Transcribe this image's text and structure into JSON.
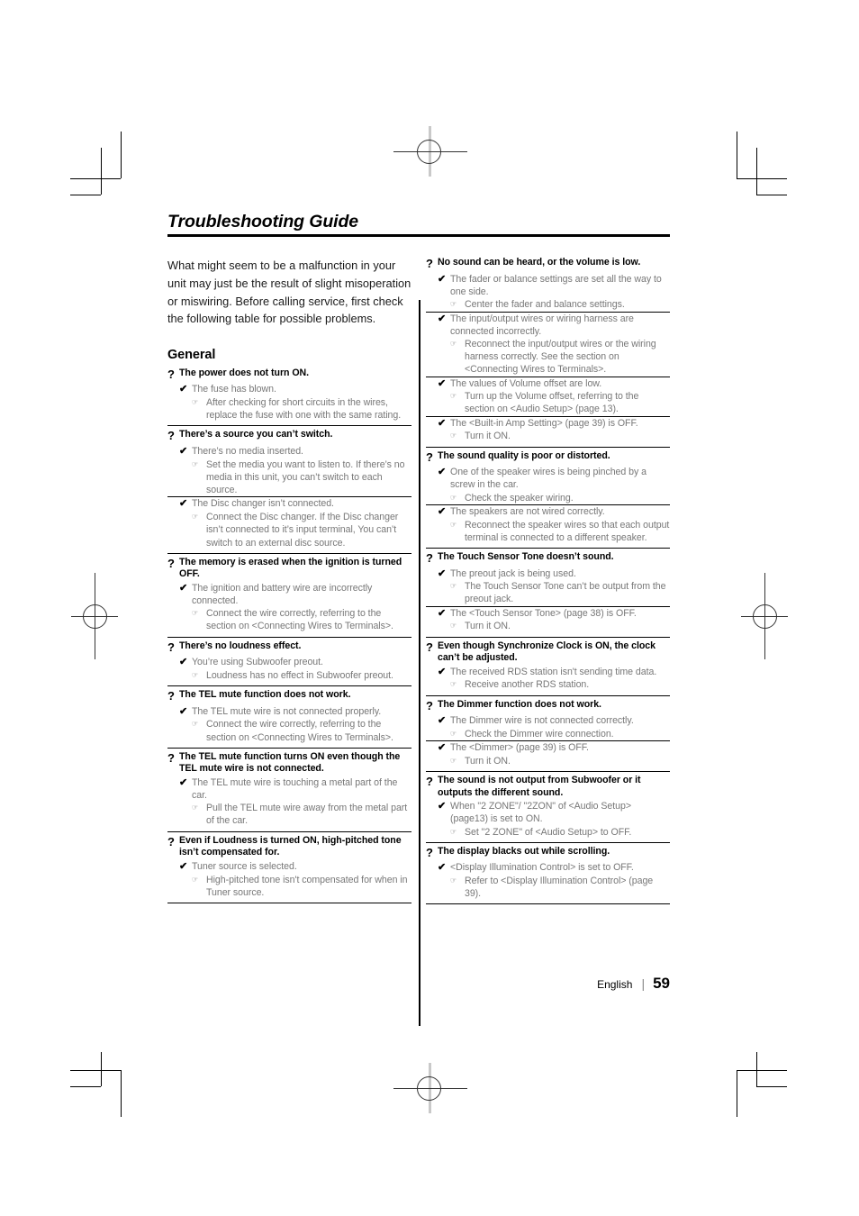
{
  "document": {
    "title": "Troubleshooting Guide",
    "intro": "What might seem to be a malfunction in your unit may just be the result of slight misoperation or miswiring. Before calling service, first check the following table for possible problems.",
    "section_heading": "General"
  },
  "markers": {
    "question": "?",
    "cause": "✔",
    "action": "☞"
  },
  "footer": {
    "language": "English",
    "separator": "|",
    "page_number": "59"
  },
  "left_column": [
    {
      "question": "The power does not turn ON.",
      "causes": [
        {
          "cause": "The fuse has blown.",
          "actions": [
            "After checking for short circuits in the wires, replace the fuse with one with the same rating."
          ]
        }
      ]
    },
    {
      "question": "There’s a source you can’t switch.",
      "causes": [
        {
          "cause": "There’s no media inserted.",
          "actions": [
            "Set the media you want to listen to. If there’s no media in this unit, you can’t switch to each source."
          ]
        },
        {
          "cause": "The Disc changer isn’t connected.",
          "actions": [
            "Connect the Disc changer. If the Disc changer isn’t connected to it’s input terminal, You can’t switch to an external disc source."
          ]
        }
      ]
    },
    {
      "question": "The memory is erased when the ignition is turned OFF.",
      "causes": [
        {
          "cause": "The ignition and battery wire are incorrectly connected.",
          "actions": [
            "Connect the wire correctly, referring to the section on <Connecting Wires to Terminals>."
          ]
        }
      ]
    },
    {
      "question": "There’s no loudness effect.",
      "causes": [
        {
          "cause": "You’re using Subwoofer preout.",
          "actions": [
            "Loudness has no effect in Subwoofer preout."
          ]
        }
      ]
    },
    {
      "question": "The TEL mute function does not work.",
      "causes": [
        {
          "cause": "The TEL mute wire is not connected properly.",
          "actions": [
            "Connect the wire correctly, referring to the section on <Connecting Wires to Terminals>."
          ]
        }
      ]
    },
    {
      "question": "The TEL mute function turns ON even though the TEL mute wire is not connected.",
      "causes": [
        {
          "cause": "The TEL mute wire is touching a metal part of the car.",
          "actions": [
            "Pull the TEL mute wire away from the metal part of the car."
          ]
        }
      ]
    },
    {
      "question": "Even if Loudness is turned ON, high-pitched tone isn’t compensated for.",
      "causes": [
        {
          "cause": "Tuner source is selected.",
          "actions": [
            "High-pitched tone isn't compensated for when in Tuner source."
          ]
        }
      ]
    }
  ],
  "right_column": [
    {
      "question": "No sound can be heard, or the volume is low.",
      "causes": [
        {
          "cause": "The fader or balance settings are set all the way to one side.",
          "actions": [
            "Center the fader and balance settings."
          ]
        },
        {
          "cause": "The input/output wires or wiring harness are connected incorrectly.",
          "actions": [
            "Reconnect the input/output wires or the wiring harness correctly. See the section on <Connecting Wires to Terminals>."
          ]
        },
        {
          "cause": "The values of Volume offset are low.",
          "actions": [
            "Turn up the Volume offset, referring to the section on <Audio Setup> (page 13)."
          ]
        },
        {
          "cause": "The <Built-in Amp Setting> (page 39) is OFF.",
          "actions": [
            "Turn it ON."
          ]
        }
      ]
    },
    {
      "question": "The sound quality is poor or distorted.",
      "causes": [
        {
          "cause": "One of the speaker wires is being pinched by a screw in the car.",
          "actions": [
            "Check the speaker wiring."
          ]
        },
        {
          "cause": "The speakers are not wired correctly.",
          "actions": [
            "Reconnect the speaker wires so that each output terminal is connected to a different speaker."
          ]
        }
      ]
    },
    {
      "question": "The Touch Sensor Tone doesn’t sound.",
      "causes": [
        {
          "cause": "The preout jack is being used.",
          "actions": [
            "The Touch Sensor Tone can’t be output from the preout jack."
          ]
        },
        {
          "cause": "The <Touch Sensor Tone> (page 38) is OFF.",
          "actions": [
            "Turn it ON."
          ]
        }
      ]
    },
    {
      "question": "Even though Synchronize Clock is ON, the clock can’t be adjusted.",
      "causes": [
        {
          "cause": "The received RDS station isn't sending time data.",
          "actions": [
            "Receive another RDS station."
          ]
        }
      ]
    },
    {
      "question": "The Dimmer function does not work.",
      "causes": [
        {
          "cause": "The Dimmer wire is not connected correctly.",
          "actions": [
            "Check the Dimmer wire connection."
          ]
        },
        {
          "cause": "The <Dimmer> (page 39) is OFF.",
          "actions": [
            "Turn it ON."
          ]
        }
      ]
    },
    {
      "question": "The sound is not output from Subwoofer or it outputs the different sound.",
      "causes": [
        {
          "cause": "When \"2 ZONE\"/ \"2ZON\" of <Audio Setup> (page13) is set to ON.",
          "actions": [
            "Set \"2 ZONE\" of <Audio Setup> to OFF."
          ]
        }
      ]
    },
    {
      "question": "The display blacks out while scrolling.",
      "causes": [
        {
          "cause": "<Display Illumination Control> is set to OFF.",
          "actions": [
            "Refer to <Display Illumination Control> (page 39)."
          ]
        }
      ]
    }
  ]
}
